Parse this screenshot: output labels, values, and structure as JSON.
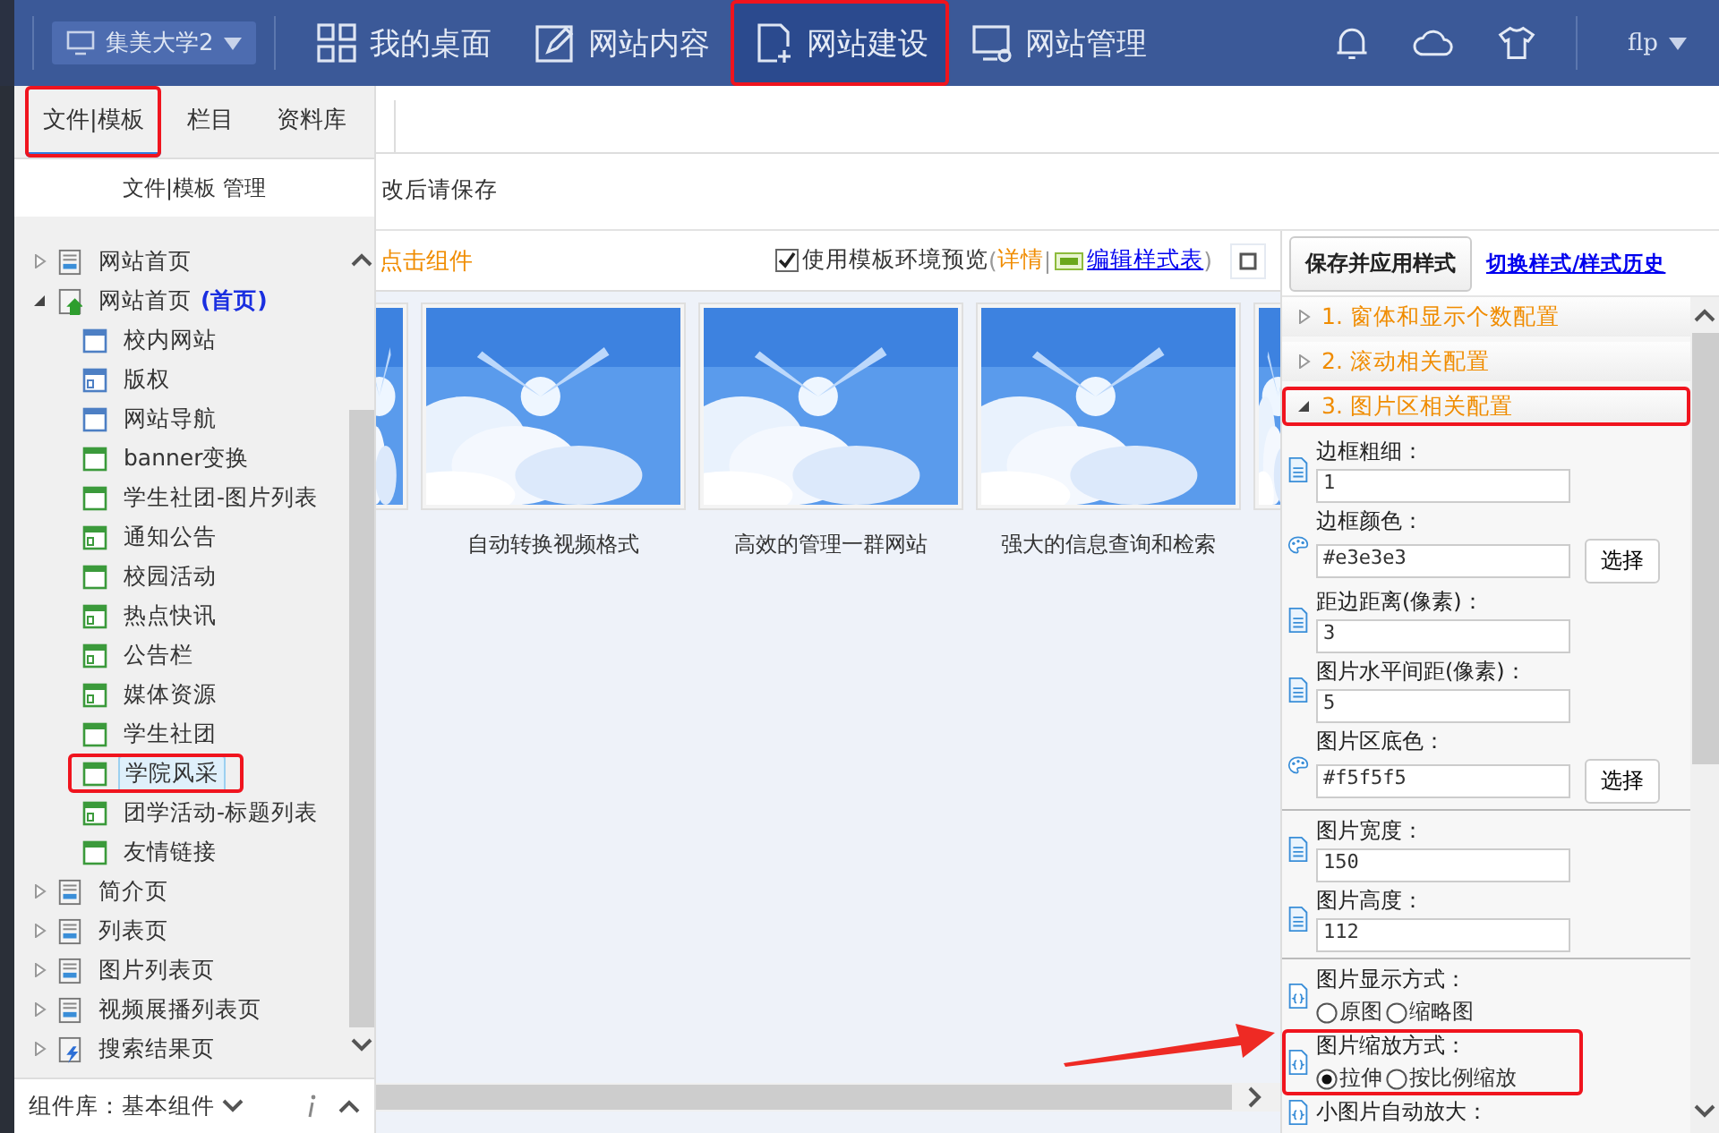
{
  "top_bar": {
    "site": "集美大学2",
    "nav": [
      {
        "label": "我的桌面",
        "selected": false,
        "highlighted": false
      },
      {
        "label": "网站内容",
        "selected": false,
        "highlighted": false
      },
      {
        "label": "网站建设",
        "selected": true,
        "highlighted": true
      },
      {
        "label": "网站管理",
        "selected": false,
        "highlighted": false
      }
    ],
    "user": "flp"
  },
  "left_panel": {
    "tabs": [
      {
        "label": "文件|模板",
        "selected": true,
        "highlighted": true
      },
      {
        "label": "栏目",
        "selected": false,
        "highlighted": false
      },
      {
        "label": "资料库",
        "selected": false,
        "highlighted": false
      }
    ],
    "heading": "文件|模板 管理",
    "tree": [
      {
        "label": "网站首页",
        "kind": "page",
        "expanded": false,
        "selected": false,
        "highlighted": false
      },
      {
        "label": "网站首页",
        "tag": "(首页)",
        "kind": "home",
        "expanded": true,
        "selected": false,
        "highlighted": false,
        "children": [
          {
            "label": "校内网站",
            "kind": "frame",
            "color": "#4d7fc4",
            "selected": false,
            "highlighted": false
          },
          {
            "label": "版权",
            "kind": "dframe",
            "color": "#4d7fc4",
            "selected": false,
            "highlighted": false
          },
          {
            "label": "网站导航",
            "kind": "frame",
            "color": "#4d7fc4",
            "selected": false,
            "highlighted": false
          },
          {
            "label": "banner变换",
            "kind": "frame",
            "color": "#3b9a3b",
            "selected": false,
            "highlighted": false
          },
          {
            "label": "学生社团-图片列表",
            "kind": "frame",
            "color": "#3b9a3b",
            "selected": false,
            "highlighted": false
          },
          {
            "label": "通知公告",
            "kind": "dframe",
            "color": "#3b9a3b",
            "selected": false,
            "highlighted": false
          },
          {
            "label": "校园活动",
            "kind": "frame",
            "color": "#3b9a3b",
            "selected": false,
            "highlighted": false
          },
          {
            "label": "热点快讯",
            "kind": "dframe",
            "color": "#3b9a3b",
            "selected": false,
            "highlighted": false
          },
          {
            "label": "公告栏",
            "kind": "dframe",
            "color": "#3b9a3b",
            "selected": false,
            "highlighted": false
          },
          {
            "label": "媒体资源",
            "kind": "dframe",
            "color": "#3b9a3b",
            "selected": false,
            "highlighted": false
          },
          {
            "label": "学生社团",
            "kind": "frame",
            "color": "#3b9a3b",
            "selected": false,
            "highlighted": false
          },
          {
            "label": "学院风采",
            "kind": "frame",
            "color": "#3b9a3b",
            "selected": true,
            "highlighted": true
          },
          {
            "label": "团学活动-标题列表",
            "kind": "dframe",
            "color": "#3b9a3b",
            "selected": false,
            "highlighted": false
          },
          {
            "label": "友情链接",
            "kind": "frame",
            "color": "#3b9a3b",
            "selected": false,
            "highlighted": false
          }
        ]
      },
      {
        "label": "简介页",
        "kind": "page",
        "expanded": false,
        "selected": false,
        "highlighted": false
      },
      {
        "label": "列表页",
        "kind": "page",
        "expanded": false,
        "selected": false,
        "highlighted": false
      },
      {
        "label": "图片列表页",
        "kind": "page",
        "expanded": false,
        "selected": false,
        "highlighted": false
      },
      {
        "label": "视频展播列表页",
        "kind": "page",
        "expanded": false,
        "selected": false,
        "highlighted": false
      },
      {
        "label": "搜索结果页",
        "kind": "search",
        "expanded": false,
        "selected": false,
        "highlighted": false
      }
    ],
    "footer": "组件库：基本组件"
  },
  "workspace": {
    "notice": "改后请保存",
    "toolbar": {
      "hint": "点击组件",
      "preview": {
        "label": "使用模板环境预览",
        "checked": true
      },
      "paren_open": "(",
      "details": "详情",
      "divider": "|",
      "stylesheet": "编辑样式表",
      "paren_close": ")"
    },
    "thumbnails": [
      {
        "kind": "picture",
        "caption": "自动转换视频格式"
      },
      {
        "kind": "picture",
        "caption": "高效的管理一群网站"
      },
      {
        "kind": "picture",
        "caption": "强大的信息查询和检索"
      }
    ]
  },
  "style_panel": {
    "save_button": "保存并应用样式",
    "history_link": "切换样式/样式历史",
    "sections": [
      {
        "number": "1.",
        "label": "窗体和显示个数配置",
        "expanded": false,
        "highlighted": false
      },
      {
        "number": "2.",
        "label": "滚动相关配置",
        "expanded": false,
        "highlighted": false
      },
      {
        "number": "3.",
        "label": "图片区相关配置",
        "expanded": true,
        "highlighted": true
      }
    ],
    "groups": [
      {
        "fields": [
          {
            "kind": "text",
            "label": "边框粗细：",
            "value": "1",
            "highlighted": false
          },
          {
            "kind": "color",
            "label": "边框颜色：",
            "value": "#e3e3e3",
            "button": "选择",
            "highlighted": false
          },
          {
            "kind": "text",
            "label": "距边距离(像素)：",
            "value": "3",
            "highlighted": false
          },
          {
            "kind": "text",
            "label": "图片水平间距(像素)：",
            "value": "5",
            "highlighted": false
          },
          {
            "kind": "color",
            "label": "图片区底色：",
            "value": "#f5f5f5",
            "button": "选择",
            "highlighted": false
          }
        ]
      },
      {
        "fields": [
          {
            "kind": "text",
            "label": "图片宽度：",
            "value": "150",
            "highlighted": false
          },
          {
            "kind": "text",
            "label": "图片高度：",
            "value": "112",
            "highlighted": false
          }
        ]
      },
      {
        "fields": [
          {
            "kind": "radio",
            "label": "图片显示方式：",
            "highlighted": false,
            "options": [
              {
                "label": "原图",
                "selected": false
              },
              {
                "label": "缩略图",
                "selected": false
              }
            ]
          },
          {
            "kind": "radio",
            "label": "图片缩放方式：",
            "highlighted": true,
            "options": [
              {
                "label": "拉伸",
                "selected": true
              },
              {
                "label": "按比例缩放",
                "selected": false
              }
            ]
          },
          {
            "kind": "radio",
            "label": "小图片自动放大：",
            "highlighted": false
          }
        ]
      }
    ]
  }
}
